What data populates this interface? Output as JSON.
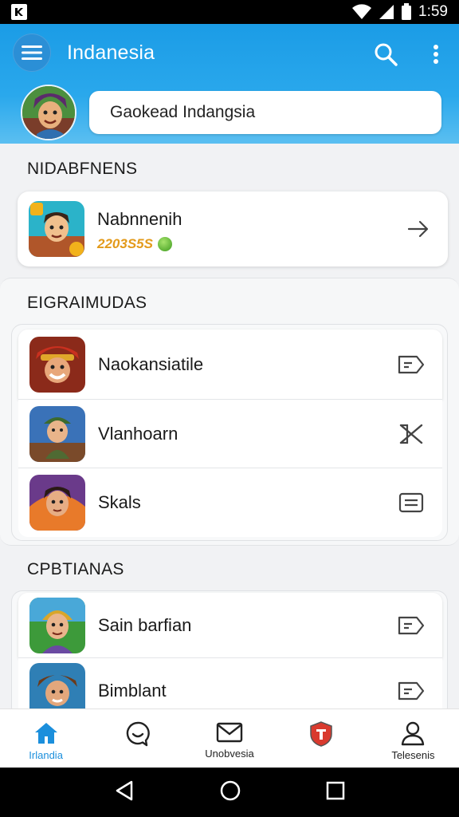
{
  "status_bar": {
    "time": "1:59"
  },
  "app": {
    "title": "Indanesia"
  },
  "search": {
    "value": "Gaokead Indangsia"
  },
  "sections": {
    "first_title": "NIDABFNENS",
    "second_title": "EIGRAIMUDAS",
    "third_title": "CPBTIANAS"
  },
  "featured": {
    "name": "Nabnnenih",
    "score": "2203S5S"
  },
  "group1": {
    "items": [
      {
        "label": "Naokansiatile",
        "action_icon": "tag-icon"
      },
      {
        "label": "Vlanhoarn",
        "action_icon": "scissors-icon"
      },
      {
        "label": "Skals",
        "action_icon": "card-icon"
      }
    ]
  },
  "group2": {
    "items": [
      {
        "label": "Sain barfian",
        "action_icon": "tag-icon"
      },
      {
        "label": "Bimblant",
        "action_icon": "tag-icon"
      }
    ]
  },
  "bottom_nav": {
    "items": [
      {
        "label": "Irlandia",
        "icon": "home-icon",
        "active": true
      },
      {
        "label": "",
        "icon": "chat-icon",
        "active": false
      },
      {
        "label": "Unobvesia",
        "icon": "mail-icon",
        "active": false
      },
      {
        "label": "",
        "icon": "shield-icon",
        "active": false
      },
      {
        "label": "Telesenis",
        "icon": "person-icon",
        "active": false
      }
    ]
  },
  "colors": {
    "header": "#1b9ce6",
    "accent": "#1b8fdc",
    "background": "#f1f2f4"
  }
}
